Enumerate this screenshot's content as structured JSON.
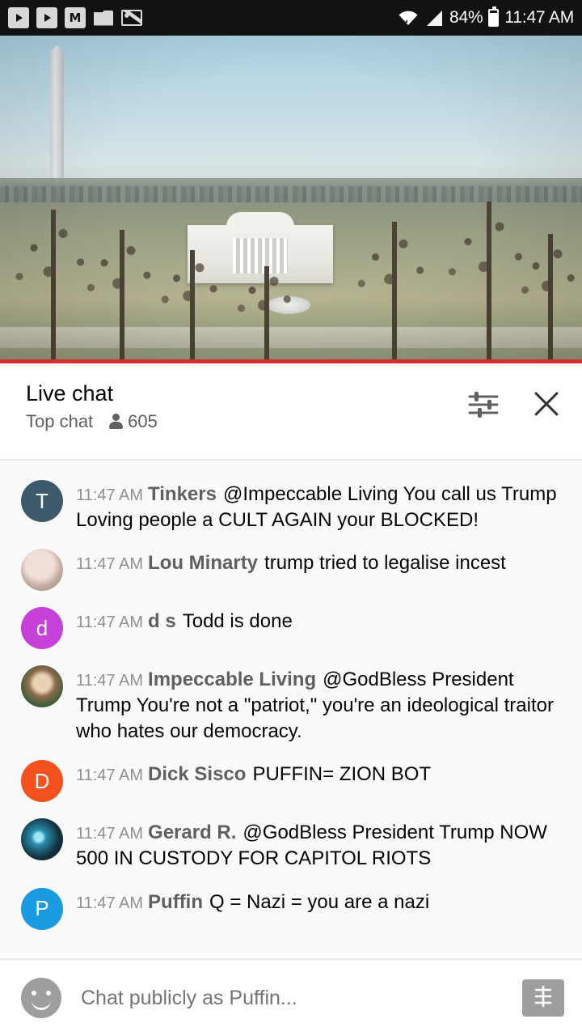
{
  "status_bar": {
    "icons": [
      "play-icon",
      "play-icon",
      "m-icon",
      "folder-icon",
      "photo-icon"
    ],
    "m_label": "M",
    "wifi": "wifi-icon",
    "signal": "signal-icon",
    "battery_percent": "84%",
    "time": "11:47 AM"
  },
  "video": {
    "name": "live-stream-white-house",
    "progress_color": "#d32f2f"
  },
  "chat_header": {
    "title": "Live chat",
    "mode": "Top chat",
    "viewers": "605",
    "settings_icon": "sliders-icon",
    "close_icon": "close-icon"
  },
  "messages": [
    {
      "avatar_type": "letter",
      "avatar_letter": "T",
      "avatar_color": "#3d5a6c",
      "time": "11:47 AM",
      "author": "Tinkers",
      "text": "@Impeccable Living You call us Trump Loving people a CULT AGAIN your BLOCKED!"
    },
    {
      "avatar_type": "photo-a",
      "avatar_letter": "",
      "avatar_color": "#c9aea5",
      "time": "11:47 AM",
      "author": "Lou Minarty",
      "text": "trump tried to legalise incest"
    },
    {
      "avatar_type": "letter",
      "avatar_letter": "d",
      "avatar_color": "#c740d8",
      "time": "11:47 AM",
      "author": "d s",
      "text": "Todd is done"
    },
    {
      "avatar_type": "photo-b",
      "avatar_letter": "",
      "avatar_color": "#8d6a4a",
      "time": "11:47 AM",
      "author": "Impeccable Living",
      "text": "@GodBless President Trump You're not a \"patriot,\" you're an ideological traitor who hates our democracy."
    },
    {
      "avatar_type": "letter",
      "avatar_letter": "D",
      "avatar_color": "#f4511e",
      "time": "11:47 AM",
      "author": "Dick Sisco",
      "text": "PUFFIN= ZION BOT"
    },
    {
      "avatar_type": "photo-c",
      "avatar_letter": "",
      "avatar_color": "#12323f",
      "time": "11:47 AM",
      "author": "Gerard R.",
      "text": "@GodBless President Trump NOW 500 IN CUSTODY FOR CAPITOL RIOTS"
    },
    {
      "avatar_type": "letter",
      "avatar_letter": "P",
      "avatar_color": "#1a9ae0",
      "time": "11:47 AM",
      "author": "Puffin",
      "text": "Q = Nazi = you are a nazi"
    }
  ],
  "composer": {
    "emoji_icon": "emoji-icon",
    "placeholder": "Chat publicly as Puffin...",
    "value": "",
    "send_icon": "super-chat-icon"
  }
}
